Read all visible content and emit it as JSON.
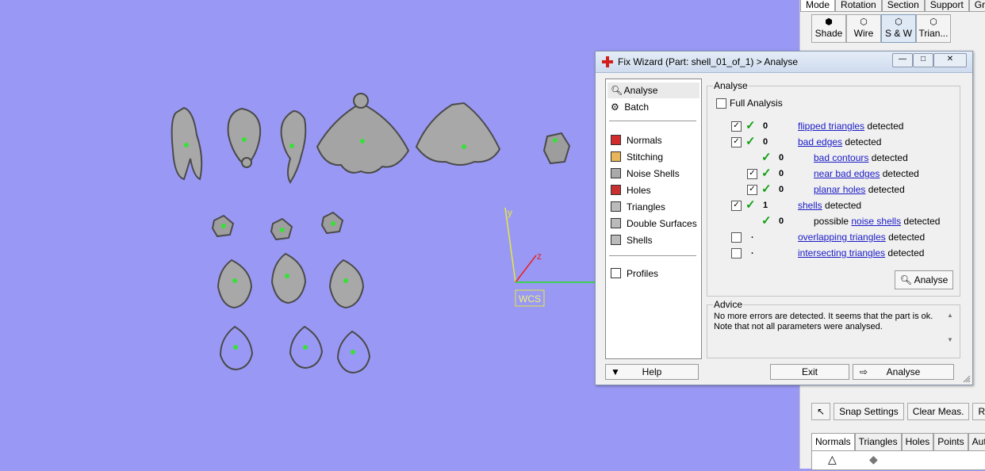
{
  "viewport": {
    "wcs_label": "WCS",
    "axis_y": "y",
    "axis_z": "z"
  },
  "right_panel": {
    "mode_tabs": [
      "Mode",
      "Rotation",
      "Section",
      "Support",
      "Grid"
    ],
    "mode_buttons": [
      {
        "label": "Shade",
        "icon": "shade-icon"
      },
      {
        "label": "Wire",
        "icon": "wire-icon"
      },
      {
        "label": "S & W",
        "icon": "shade-wire-icon"
      },
      {
        "label": "Trian...",
        "icon": "triangles-icon"
      }
    ],
    "toolbar": {
      "snap_settings": "Snap Settings",
      "clear_meas": "Clear Meas.",
      "report": "Repo"
    },
    "bottom_tabs": [
      "Normals",
      "Triangles",
      "Holes",
      "Points",
      "Auto"
    ]
  },
  "dialog": {
    "title": "Fix Wizard (Part: shell_01_of_1) > Analyse",
    "left_list": {
      "items_top": [
        {
          "label": "Analyse",
          "icon": "magnifier-icon"
        },
        {
          "label": "Batch",
          "icon": "batch-icon"
        }
      ],
      "items_mid": [
        {
          "label": "Normals",
          "icon": "normals-icon",
          "color": "#d22b2b"
        },
        {
          "label": "Stitching",
          "icon": "stitching-icon",
          "color": "#e8b55a"
        },
        {
          "label": "Noise Shells",
          "icon": "noise-shells-icon",
          "color": "#aaaaaa"
        },
        {
          "label": "Holes",
          "icon": "holes-icon",
          "color": "#c83030"
        },
        {
          "label": "Triangles",
          "icon": "triangles-icon",
          "color": "#bbbbbb"
        },
        {
          "label": "Double Surfaces",
          "icon": "double-surfaces-icon",
          "color": "#bbbbbb"
        },
        {
          "label": "Shells",
          "icon": "shells-icon",
          "color": "#bbbbbb"
        }
      ],
      "items_bottom": [
        {
          "label": "Profiles",
          "icon": "profiles-icon"
        }
      ]
    },
    "analyse": {
      "group_label": "Analyse",
      "full_analysis": "Full Analysis",
      "rows": {
        "flipped": {
          "count": "0",
          "link": "flipped triangles",
          "suffix": "detected"
        },
        "bad_edges": {
          "count": "0",
          "link": "bad edges",
          "suffix": "detected"
        },
        "bad_contours": {
          "count": "0",
          "link": "bad contours",
          "suffix": "detected"
        },
        "near_bad_edges": {
          "count": "0",
          "link": "near bad edges",
          "suffix": "detected"
        },
        "planar_holes": {
          "count": "0",
          "link": "planar holes",
          "suffix": "detected"
        },
        "shells": {
          "count": "1",
          "link": "shells",
          "suffix": "detected"
        },
        "noise_shells": {
          "count": "0",
          "prefix": "possible",
          "link": "noise shells",
          "suffix": "detected"
        },
        "overlapping": {
          "count": ".",
          "link": "overlapping triangles",
          "suffix": "detected"
        },
        "intersecting": {
          "count": ".",
          "link": "intersecting triangles",
          "suffix": "detected"
        }
      },
      "analyse_button": "Analyse"
    },
    "advice": {
      "group_label": "Advice",
      "text": "No more errors are detected. It seems that the part is ok. Note that not all parameters were analysed."
    },
    "footer": {
      "help": "Help",
      "exit": "Exit",
      "analyse": "Analyse"
    }
  }
}
